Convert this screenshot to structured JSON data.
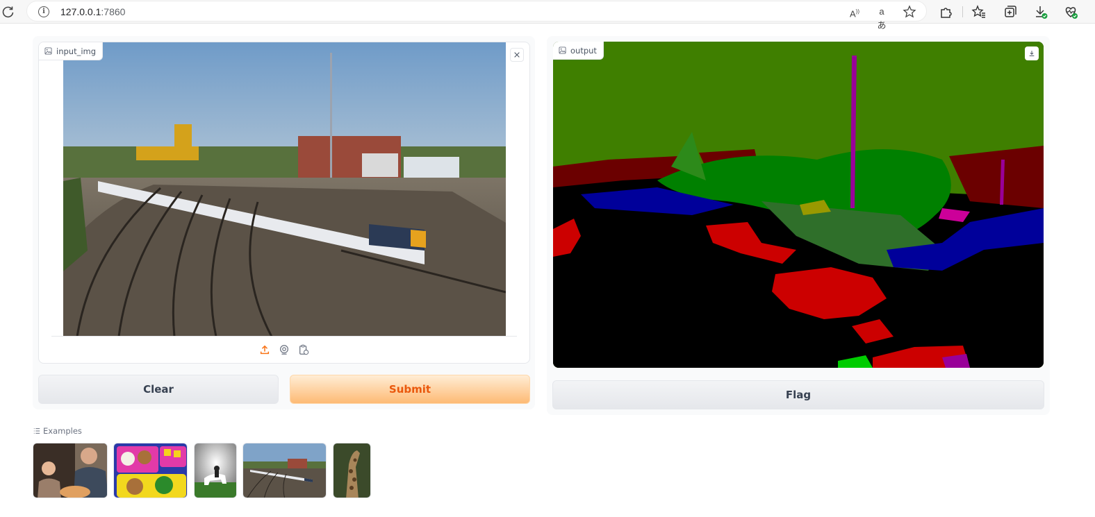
{
  "browser": {
    "url_host": "127.0.0.1",
    "url_port": ":7860",
    "read_aloud_glyph": "A",
    "translate_glyph": "aあ"
  },
  "input": {
    "label": "input_img"
  },
  "output": {
    "label": "output"
  },
  "buttons": {
    "clear": "Clear",
    "submit": "Submit",
    "flag": "Flag"
  },
  "examples": {
    "label": "Examples",
    "items": [
      "family-dinner",
      "bento-box",
      "horse-rider",
      "train-yard",
      "giraffe"
    ]
  },
  "colors": {
    "accent": "#f97316",
    "submit_text": "#ea580c",
    "segmentation_palette": [
      "#3f7f00",
      "#000000",
      "#cc0000",
      "#6b0000",
      "#008000",
      "#00009a",
      "#990099"
    ]
  }
}
